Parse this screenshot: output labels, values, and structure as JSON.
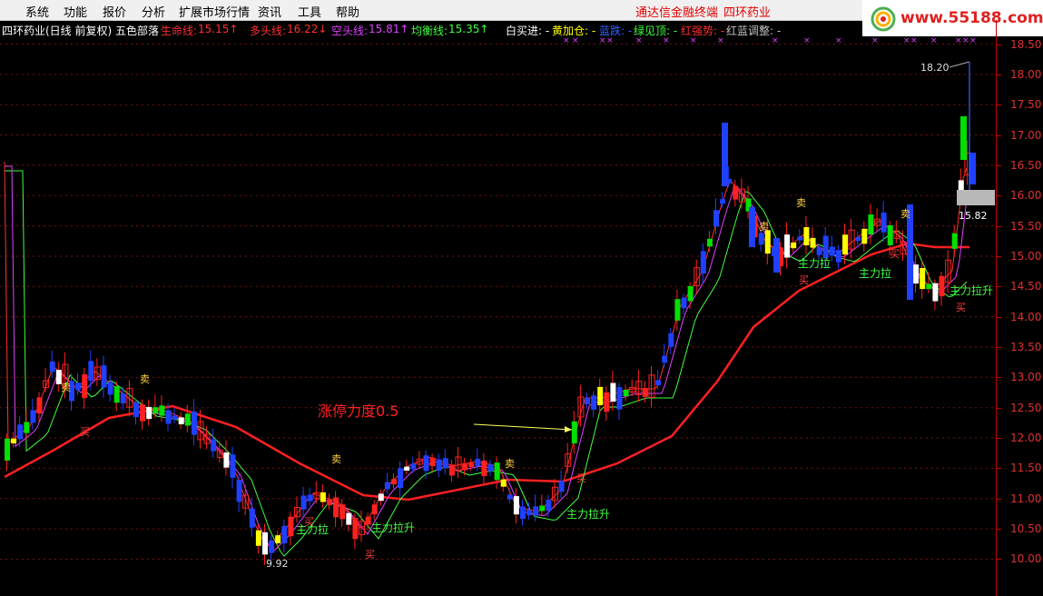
{
  "menu": [
    "系统",
    "功能",
    "报价",
    "分析",
    "扩展市场行情",
    "资讯",
    "工具",
    "帮助"
  ],
  "brand": "通达信金融终端",
  "stock_name": "四环药业",
  "logo_url": "www.55188.com",
  "info": {
    "title": "四环药业(日线 前复权) 五色部落",
    "lifeline_label": "生命线:",
    "lifeline_value": "15.15↑",
    "long_label": "多头线:",
    "long_value": "16.22↓",
    "short_label": "空头线:",
    "short_value": "15.81↑",
    "balance_label": "均衡线:",
    "balance_value": "15.35↑",
    "white_buy": "白买进: -",
    "yellow_add": "黄加仓: -",
    "blue_dip": "蓝跌: -",
    "green_top": "绿见顶: -",
    "red_strong": "红强势: -",
    "redblue_adjust": "红蓝调整: -"
  },
  "colors": {
    "red": "#ff2020",
    "green": "#00e000",
    "blue": "#2040ff",
    "yellow": "#ffff00",
    "white": "#ffffff",
    "magenta": "#e040ff",
    "lime": "#40ff40",
    "axis_red": "#e03030"
  },
  "annotations": {
    "big_label": "涨停力度0.5",
    "high_marker": "18.20",
    "low_marker": "9.92",
    "price_tag": "15.82",
    "buy": "买",
    "sell": "卖",
    "main_force": "主力拉升",
    "main_force_short": "主力拉",
    "main_force_right": "主力拉升"
  },
  "chart_data": {
    "type": "candlestick",
    "y_ticks": [
      "18.50",
      "18.00",
      "17.50",
      "17.00",
      "16.50",
      "16.00",
      "15.50",
      "15.00",
      "14.50",
      "14.00",
      "13.50",
      "13.00",
      "12.50",
      "12.00",
      "11.50",
      "11.00",
      "10.50",
      "10.00"
    ],
    "ylim": [
      9.7,
      18.75
    ]
  }
}
